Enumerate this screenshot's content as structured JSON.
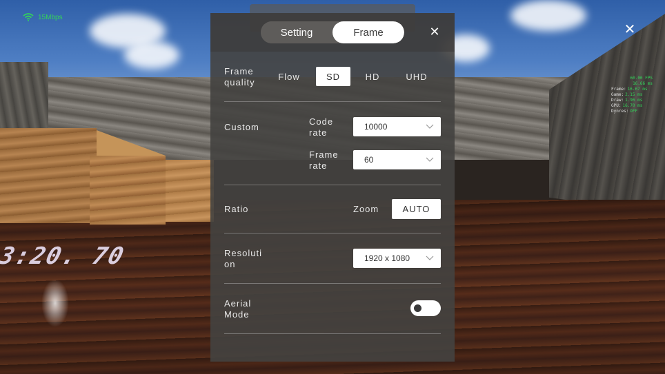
{
  "status": {
    "network_label": "15Mbps"
  },
  "stats": {
    "fps": "60.00 FPS",
    "frame_ms": "16.66 ms",
    "rows": [
      {
        "label": "Frame:",
        "value": "16.67 ms"
      },
      {
        "label": "Game:",
        "value": "2.15 ms"
      },
      {
        "label": "Draw:",
        "value": "1.96 ms"
      },
      {
        "label": "GPU:",
        "value": "16.70 ms"
      },
      {
        "label": "Dynres:",
        "value": "OFF"
      }
    ]
  },
  "scene": {
    "floor_text": "3:20. 70"
  },
  "tabs": [
    {
      "label": "Setting",
      "active": false
    },
    {
      "label": "Frame",
      "active": true
    }
  ],
  "panel": {
    "frame_quality": {
      "label": "Frame quality",
      "options": [
        "Flow",
        "SD",
        "HD",
        "UHD"
      ],
      "selected": "SD"
    },
    "custom": {
      "label": "Custom",
      "code_rate": {
        "label": "Code rate",
        "value": "10000"
      },
      "frame_rate": {
        "label": "Frame rate",
        "value": "60"
      }
    },
    "ratio": {
      "label": "Ratio",
      "zoom_label": "Zoom",
      "button": "AUTO"
    },
    "resolution": {
      "label": "Resoluti on",
      "value": "1920 x 1080"
    },
    "aerial_mode": {
      "label": "Aerial Mode",
      "enabled": false
    }
  },
  "icons": {
    "close": "close-icon",
    "wifi": "wifi-icon",
    "chevron": "chevron-down-icon"
  }
}
